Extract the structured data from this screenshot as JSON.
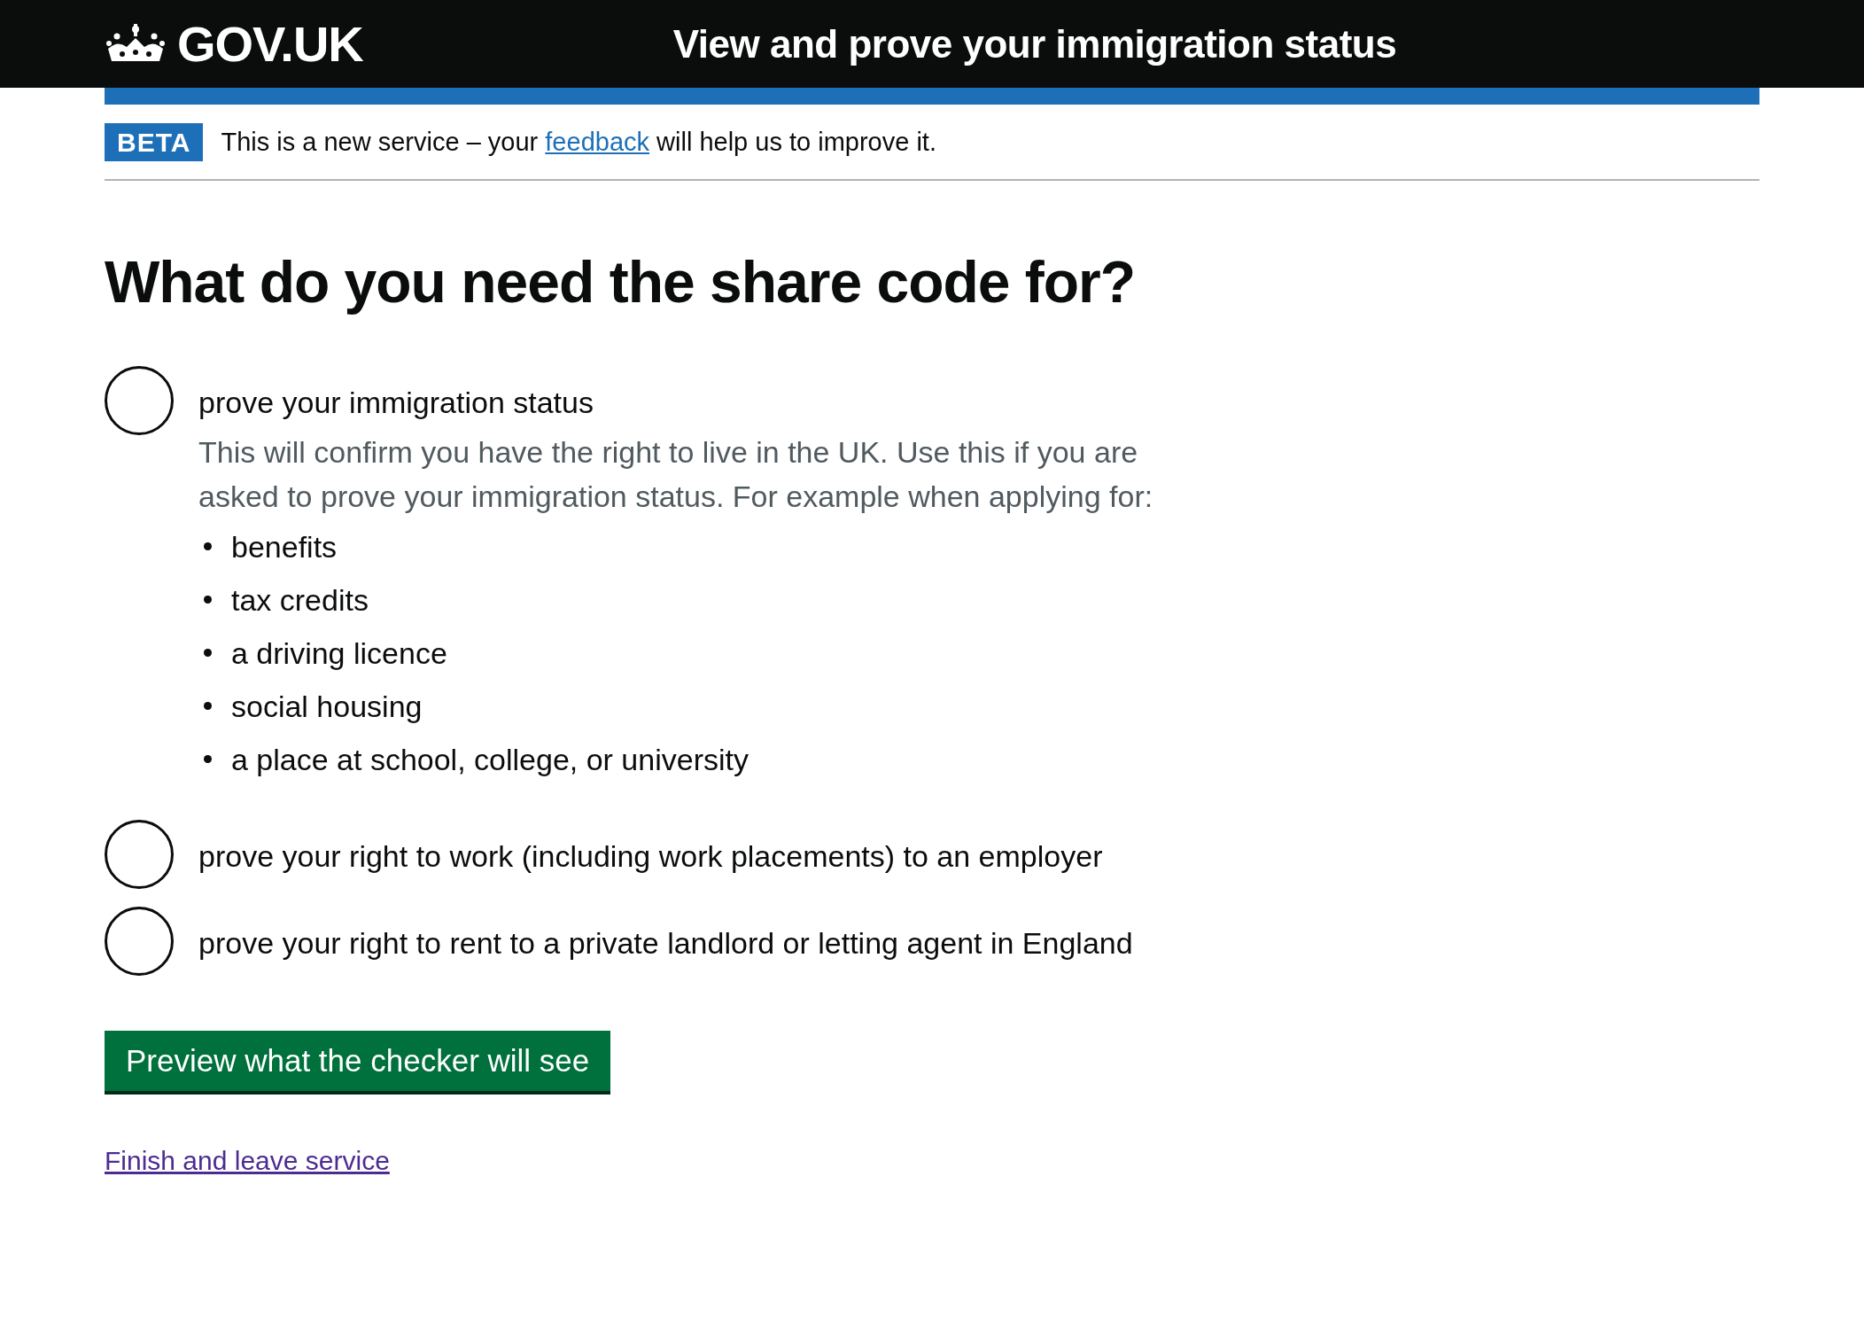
{
  "header": {
    "logo_text": "GOV.UK",
    "service_name": "View and prove your immigration status"
  },
  "phase_banner": {
    "tag": "BETA",
    "text_before": "This is a new service – your",
    "link": "feedback",
    "text_after": "will help us to improve it."
  },
  "heading": "What do you need the share code for?",
  "options": [
    {
      "label": "prove your immigration status",
      "selected": false,
      "hint": "This will confirm you have the right to live in the UK. Use this if you are asked to prove your immigration status. For example when applying for:",
      "bullets": [
        "benefits",
        "tax credits",
        "a driving licence",
        "social housing",
        "a place at school, college, or university"
      ]
    },
    {
      "label": "prove your right to work (including work placements) to an employer",
      "selected": false
    },
    {
      "label": "prove your right to rent to a private landlord or letting agent in England",
      "selected": false
    }
  ],
  "button": "Preview what the checker will see",
  "exit_link": "Finish and leave service"
}
